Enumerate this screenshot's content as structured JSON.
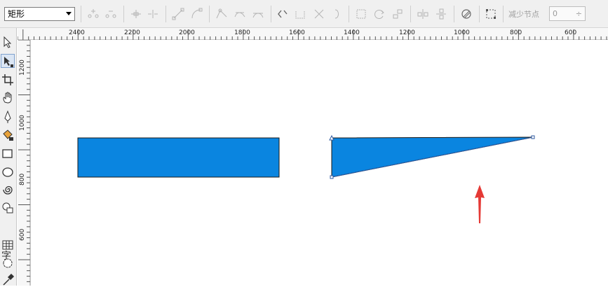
{
  "propbar": {
    "shape_select": "矩形",
    "reduce_nodes_label": "减少节点",
    "reduce_nodes_value": "0",
    "reduce_nodes_spinner": "÷",
    "icons": [
      "add-node-icon",
      "delete-node-icon",
      "join-nodes-icon",
      "break-curve-icon",
      "to-line-icon",
      "to-curve-icon",
      "cusp-node-icon",
      "smooth-node-icon",
      "symmetric-node-icon",
      "reverse-direction-icon",
      "extend-close-icon",
      "extract-subpath-icon",
      "auto-close-icon",
      "stretch-scale-icon",
      "rotate-skew-icon",
      "align-nodes-icon",
      "horizontal-reflect-icon",
      "vertical-reflect-icon",
      "elastic-mode-icon",
      "select-all-nodes-icon"
    ]
  },
  "ruler": {
    "horizontal": [
      "2400",
      "2200",
      "2000",
      "1800",
      "1600",
      "1400",
      "1200",
      "1000",
      "800",
      "600"
    ],
    "vertical": [
      "1200",
      "1000",
      "800",
      "600"
    ]
  },
  "toolbox": {
    "tools": [
      "pick-tool-icon",
      "shape-tool-icon",
      "crop-tool-icon",
      "pan-tool-icon",
      "freehand-tool-icon",
      "smart-fill-icon",
      "rectangle-tool-icon",
      "ellipse-tool-icon",
      "spiral-tool-icon",
      "basic-shapes-icon",
      "text-tool-icon",
      "table-tool-icon",
      "interactive-tool-icon",
      "eyedropper-tool-icon"
    ],
    "text_tool_glyph": "字"
  },
  "canvas": {
    "fill_color": "#0a85e0",
    "outline_color": "#1a1a1a",
    "arrow_color": "#e53935",
    "selection_color": "#2f5aa0"
  }
}
